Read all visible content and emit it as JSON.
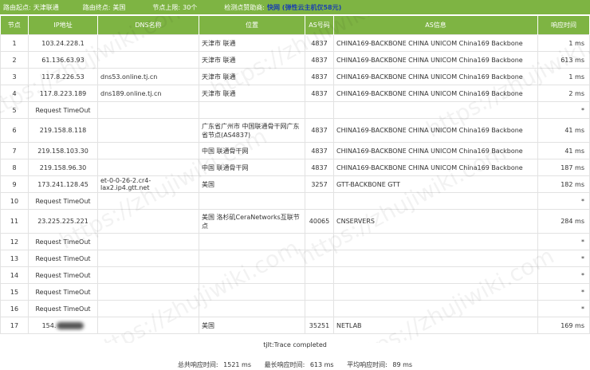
{
  "topbar": {
    "start_label": "路由起点:",
    "start_value": "天津联通",
    "end_label": "路由终点:",
    "end_value": "美国",
    "limit_label": "节点上限:",
    "limit_value": "30个",
    "sponsor_label": "检测点赞助商:",
    "sponsor_value": "快网 (弹性云主机仅58元)"
  },
  "table": {
    "headers": [
      "节点",
      "IP地址",
      "DNS名称",
      "位置",
      "AS号码",
      "AS信息",
      "响应时间"
    ],
    "rows": [
      {
        "hop": "1",
        "ip": "103.24.228.1",
        "dns": "",
        "loc": "天津市 联通",
        "as": "4837",
        "asinfo": "CHINA169-BACKBONE CHINA UNICOM China169 Backbone",
        "time": "1 ms"
      },
      {
        "hop": "2",
        "ip": "61.136.63.93",
        "dns": "",
        "loc": "天津市 联通",
        "as": "4837",
        "asinfo": "CHINA169-BACKBONE CHINA UNICOM China169 Backbone",
        "time": "613 ms"
      },
      {
        "hop": "3",
        "ip": "117.8.226.53",
        "dns": "dns53.online.tj.cn",
        "loc": "天津市 联通",
        "as": "4837",
        "asinfo": "CHINA169-BACKBONE CHINA UNICOM China169 Backbone",
        "time": "1 ms"
      },
      {
        "hop": "4",
        "ip": "117.8.223.189",
        "dns": "dns189.online.tj.cn",
        "loc": "天津市 联通",
        "as": "4837",
        "asinfo": "CHINA169-BACKBONE CHINA UNICOM China169 Backbone",
        "time": "2 ms"
      },
      {
        "hop": "5",
        "ip": "Request TimeOut",
        "dns": "",
        "loc": "",
        "as": "",
        "asinfo": "",
        "time": "*"
      },
      {
        "hop": "6",
        "ip": "219.158.8.118",
        "dns": "",
        "loc": "广东省广州市 中国联通骨干网广东省节点(AS4837)",
        "as": "4837",
        "asinfo": "CHINA169-BACKBONE CHINA UNICOM China169 Backbone",
        "time": "41 ms"
      },
      {
        "hop": "7",
        "ip": "219.158.103.30",
        "dns": "",
        "loc": "中国 联通骨干网",
        "as": "4837",
        "asinfo": "CHINA169-BACKBONE CHINA UNICOM China169 Backbone",
        "time": "41 ms"
      },
      {
        "hop": "8",
        "ip": "219.158.96.30",
        "dns": "",
        "loc": "中国 联通骨干网",
        "as": "4837",
        "asinfo": "CHINA169-BACKBONE CHINA UNICOM China169 Backbone",
        "time": "187 ms"
      },
      {
        "hop": "9",
        "ip": "173.241.128.45",
        "dns": "et-0-0-26-2.cr4-lax2.ip4.gtt.net",
        "loc": "美国",
        "as": "3257",
        "asinfo": "GTT-BACKBONE GTT",
        "time": "182 ms"
      },
      {
        "hop": "10",
        "ip": "Request TimeOut",
        "dns": "",
        "loc": "",
        "as": "",
        "asinfo": "",
        "time": "*"
      },
      {
        "hop": "11",
        "ip": "23.225.225.221",
        "dns": "",
        "loc": "美国 洛杉矶CeraNetworks互联节点",
        "as": "40065",
        "asinfo": "CNSERVERS",
        "time": "284 ms"
      },
      {
        "hop": "12",
        "ip": "Request TimeOut",
        "dns": "",
        "loc": "",
        "as": "",
        "asinfo": "",
        "time": "*"
      },
      {
        "hop": "13",
        "ip": "Request TimeOut",
        "dns": "",
        "loc": "",
        "as": "",
        "asinfo": "",
        "time": "*"
      },
      {
        "hop": "14",
        "ip": "Request TimeOut",
        "dns": "",
        "loc": "",
        "as": "",
        "asinfo": "",
        "time": "*"
      },
      {
        "hop": "15",
        "ip": "Request TimeOut",
        "dns": "",
        "loc": "",
        "as": "",
        "asinfo": "",
        "time": "*"
      },
      {
        "hop": "16",
        "ip": "Request TimeOut",
        "dns": "",
        "loc": "",
        "as": "",
        "asinfo": "",
        "time": "*"
      },
      {
        "hop": "17",
        "ip": "154.",
        "dns": "",
        "loc": "美国",
        "as": "35251",
        "asinfo": "NETLAB",
        "time": "169 ms"
      }
    ]
  },
  "footer": {
    "completed": "tjlt:Trace completed",
    "total_label": "总共响应时间:",
    "total_value": "1521 ms",
    "max_label": "最长响应时间:",
    "max_value": "613 ms",
    "avg_label": "平均响应时间:",
    "avg_value": "89 ms"
  },
  "watermark": "https://zhujiwiki.com"
}
